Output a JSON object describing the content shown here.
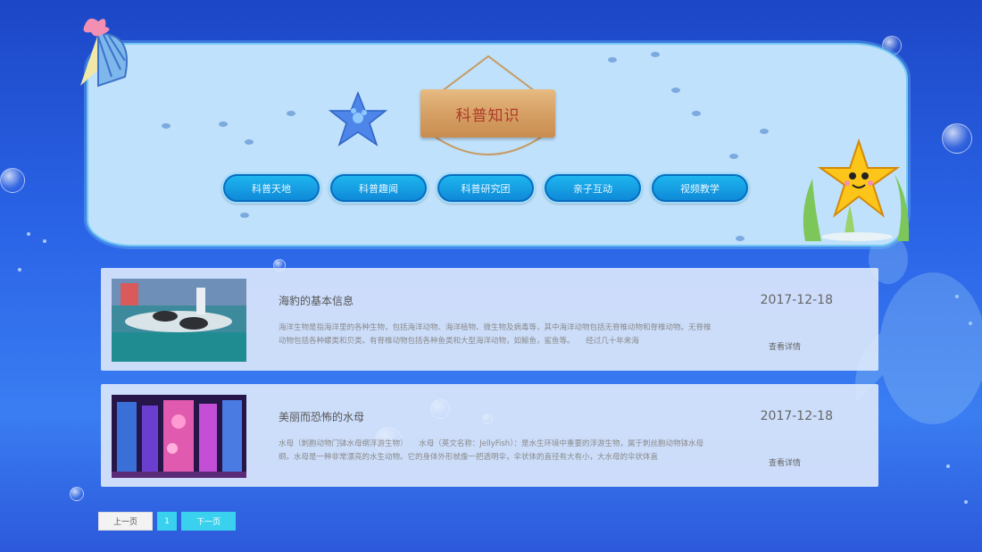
{
  "header": {
    "title": "科普知识",
    "nav": [
      "科普天地",
      "科普趣闻",
      "科普研究团",
      "亲子互动",
      "视频教学"
    ]
  },
  "articles": [
    {
      "title": "海豹的基本信息",
      "date": "2017-12-18",
      "desc": "海洋生物是指海洋里的各种生物，包括海洋动物、海洋植物、微生物及病毒等，其中海洋动物包括无脊椎动物和脊椎动物。无脊椎动物包括各种螺类和贝类。有脊椎动物包括各种鱼类和大型海洋动物，如鲸鱼，鲨鱼等。　　经过几十年来海",
      "more": "查看详情"
    },
    {
      "title": "美丽而恐怖的水母",
      "date": "2017-12-18",
      "desc": "水母（刺胞动物门钵水母纲浮游生物）　　水母（英文名称：JellyFish）：是水生环境中重要的浮游生物，属于刺丝胞动物钵水母纲。水母是一种非常漂亮的水生动物。它的身体外形就像一把透明伞，伞状体的直径有大有小，大水母的伞状体直",
      "more": "查看详情"
    }
  ],
  "pagination": {
    "prev": "上一页",
    "current": "1",
    "next": "下一页"
  },
  "colors": {
    "background": "#2a63e6",
    "panel": "#bfe1fb",
    "nav_button": "#0e86d6",
    "sign_text": "#b0392b",
    "pager_active": "#39d1ee"
  }
}
